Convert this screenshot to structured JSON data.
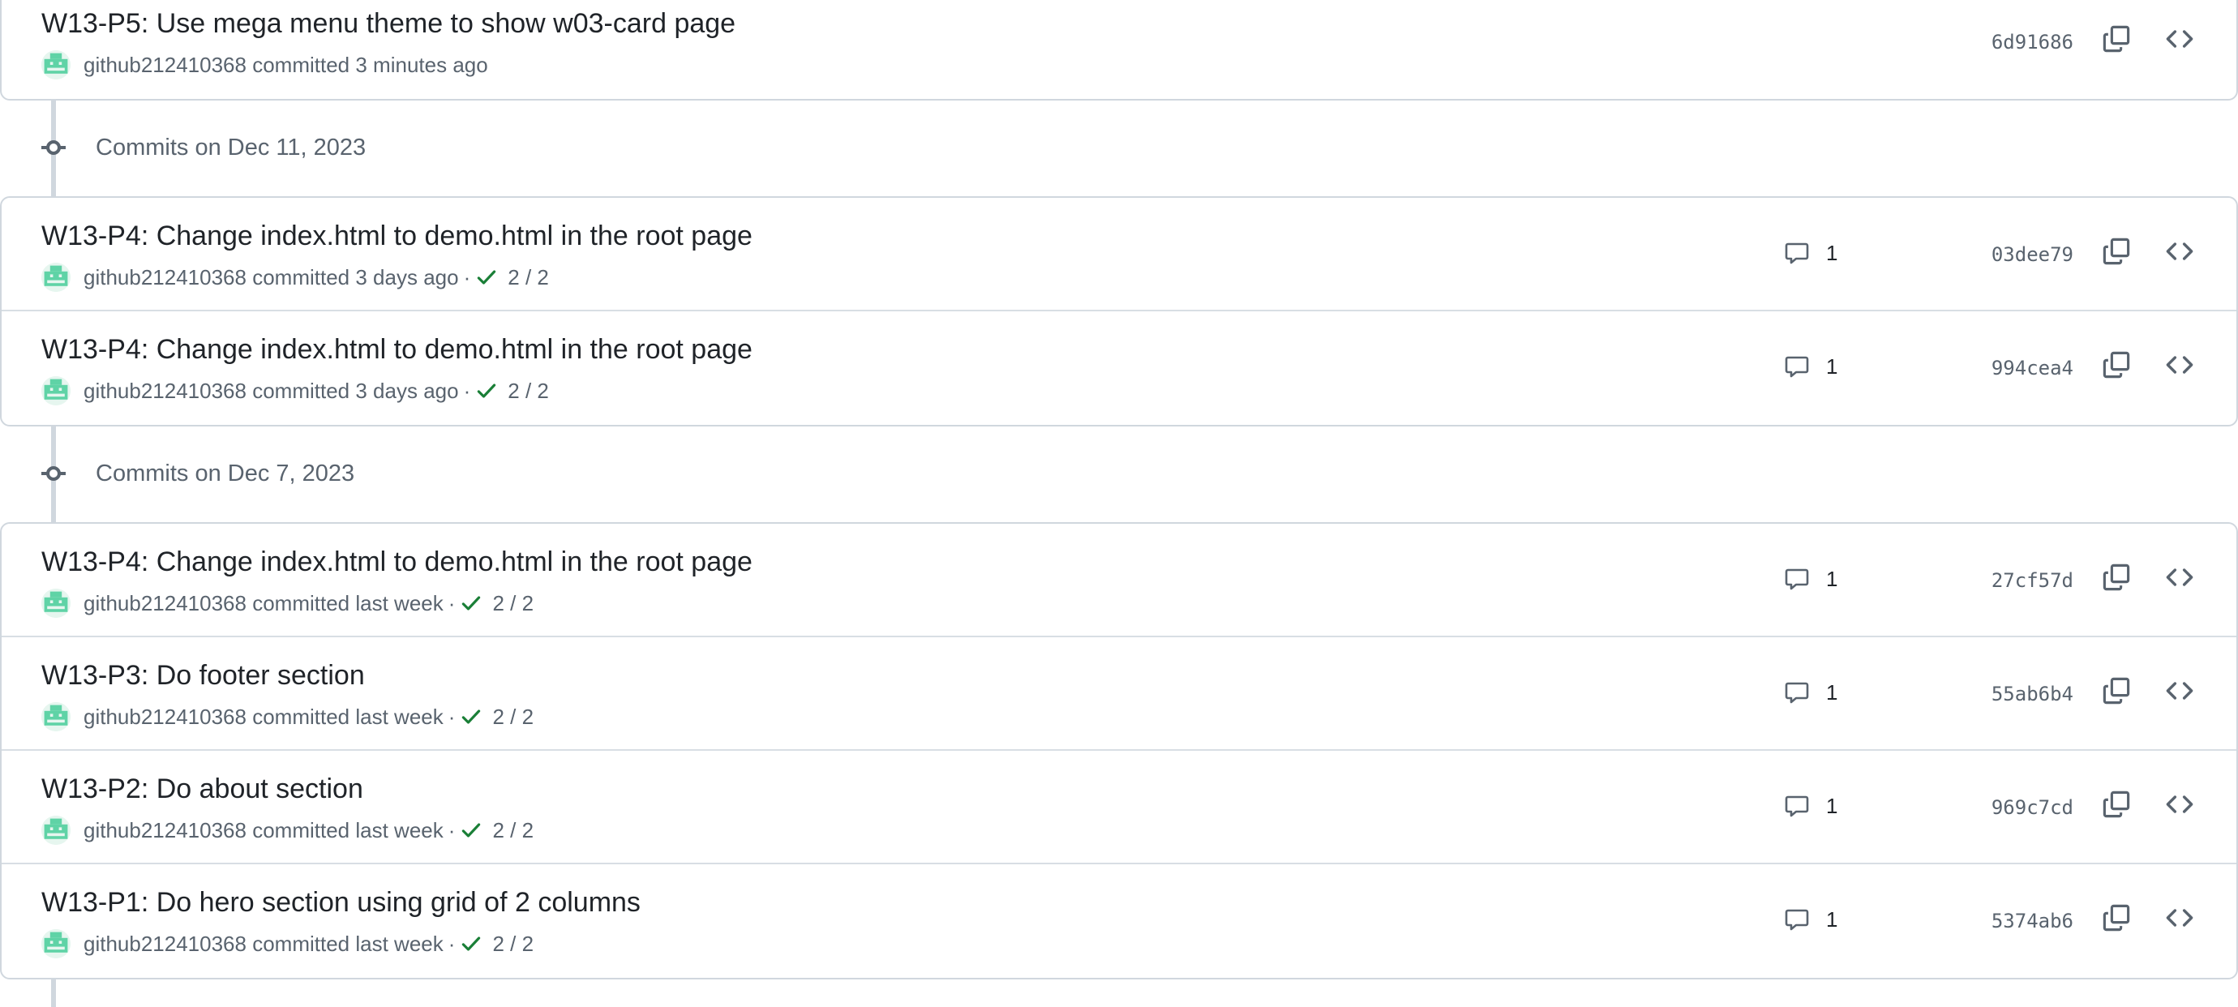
{
  "groups": [
    {
      "header": "",
      "commits": [
        {
          "title": "W13-P5: Use mega menu theme to show w03-card page",
          "author": "github212410368",
          "action": "committed",
          "time": "3 minutes ago",
          "checks": "",
          "comments": "",
          "sha": "6d91686"
        }
      ]
    },
    {
      "header": "Commits on Dec 11, 2023",
      "commits": [
        {
          "title": "W13-P4: Change index.html to demo.html in the root page",
          "author": "github212410368",
          "action": "committed",
          "time": "3 days ago",
          "checks": "2 / 2",
          "comments": "1",
          "sha": "03dee79"
        },
        {
          "title": "W13-P4: Change index.html to demo.html in the root page",
          "author": "github212410368",
          "action": "committed",
          "time": "3 days ago",
          "checks": "2 / 2",
          "comments": "1",
          "sha": "994cea4"
        }
      ]
    },
    {
      "header": "Commits on Dec 7, 2023",
      "commits": [
        {
          "title": "W13-P4: Change index.html to demo.html in the root page",
          "author": "github212410368",
          "action": "committed",
          "time": "last week",
          "checks": "2 / 2",
          "comments": "1",
          "sha": "27cf57d"
        },
        {
          "title": "W13-P3: Do footer section",
          "author": "github212410368",
          "action": "committed",
          "time": "last week",
          "checks": "2 / 2",
          "comments": "1",
          "sha": "55ab6b4"
        },
        {
          "title": "W13-P2: Do about section",
          "author": "github212410368",
          "action": "committed",
          "time": "last week",
          "checks": "2 / 2",
          "comments": "1",
          "sha": "969c7cd"
        },
        {
          "title": "W13-P1: Do hero section using grid of 2 columns",
          "author": "github212410368",
          "action": "committed",
          "time": "last week",
          "checks": "2 / 2",
          "comments": "1",
          "sha": "5374ab6"
        }
      ]
    }
  ],
  "icons": {
    "timeline": "git-commit-icon",
    "avatar": "identicon-avatar",
    "check": "check-icon",
    "comment": "comment-icon",
    "copy": "copy-icon",
    "browse": "code-icon"
  },
  "colors": {
    "success": "#1a7f37",
    "muted": "#59636e",
    "border": "#d0d7de",
    "avatar": "#5fd3a6"
  }
}
